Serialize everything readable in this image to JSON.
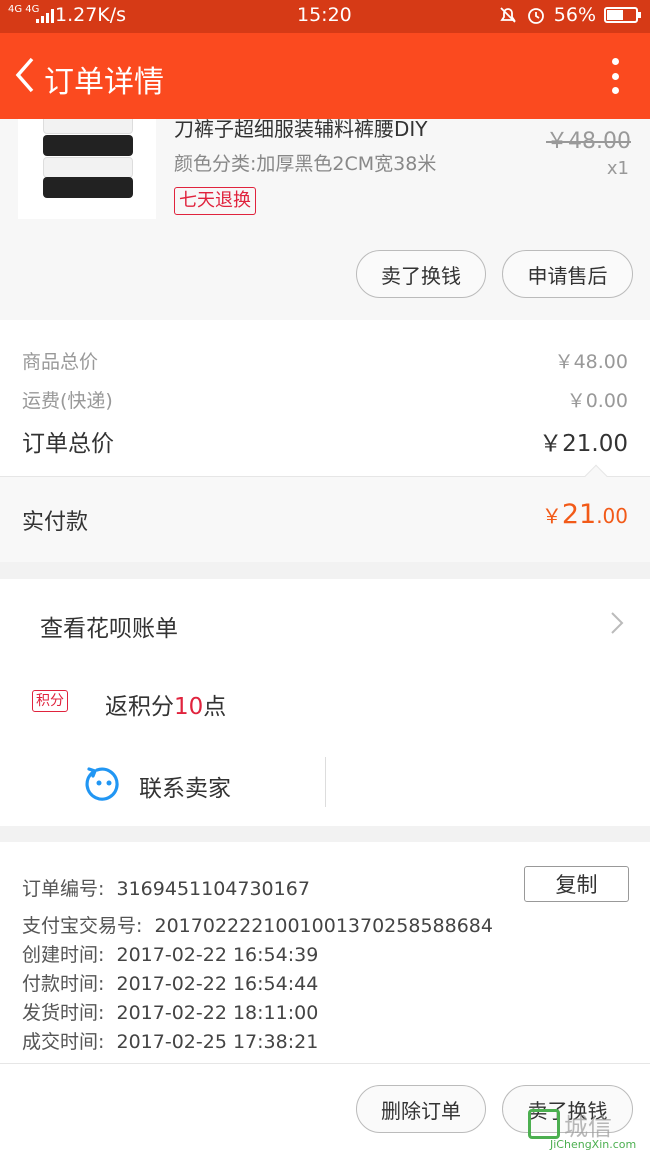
{
  "status_bar": {
    "network": "4G 4G",
    "speed": "1.27K/s",
    "time": "15:20",
    "battery": "56%",
    "battery_level": 0.56
  },
  "header": {
    "title": "订单详情",
    "back_icon": "chevron-left-icon",
    "menu_icon": "more-vertical-icon"
  },
  "product": {
    "title": "刀裤子超细服装辅料裤腰DIY",
    "sku": "颜色分类:加厚黑色2CM宽38米",
    "return_tag": "七天退换",
    "original_price": "￥48.00",
    "quantity": "x1",
    "actions": [
      "卖了换钱",
      "申请售后"
    ]
  },
  "summary": {
    "rows": [
      {
        "label": "商品总价",
        "value": "￥48.00"
      },
      {
        "label": "运费(快递)",
        "value": "￥0.00"
      },
      {
        "label": "订单总价",
        "value": "￥21.00"
      }
    ],
    "paid_label": "实付款",
    "paid_currency": "￥",
    "paid_int": "21",
    "paid_dec": ".00"
  },
  "extras": {
    "huabei": "查看花呗账单",
    "points_tag": "积分",
    "points_prefix": "返积分",
    "points_num": "10",
    "points_suffix": "点",
    "contact": "联系卖家"
  },
  "order_info": {
    "copy_button": "复制",
    "rows": [
      {
        "label": "订单编号:",
        "value": "3169451104730167"
      },
      {
        "label": "支付宝交易号:",
        "value": "2017022221001001370258588684"
      },
      {
        "label": "创建时间:",
        "value": "2017-02-22 16:54:39"
      },
      {
        "label": "付款时间:",
        "value": "2017-02-22 16:54:44"
      },
      {
        "label": "发货时间:",
        "value": "2017-02-22 18:11:00"
      },
      {
        "label": "成交时间:",
        "value": "2017-02-25 17:38:21"
      }
    ]
  },
  "bottom_actions": [
    "删除订单",
    "卖了换钱"
  ],
  "watermark": {
    "text": "城信",
    "url": "JiChengXin.com"
  },
  "colors": {
    "header": "#fb4a1f",
    "status_bar": "#d63a16",
    "accent": "#f25a18",
    "tag": "#e0233d"
  }
}
